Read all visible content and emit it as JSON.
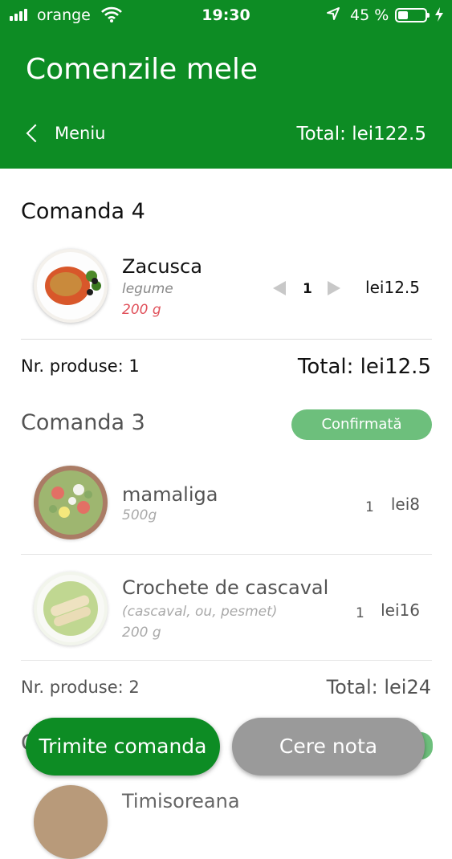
{
  "status_bar": {
    "carrier": "orange",
    "time": "19:30",
    "battery": "45 %",
    "battery_level": 0.45,
    "icons": [
      "signal-icon",
      "wifi-icon",
      "location-arrow-icon",
      "battery-icon",
      "charging-bolt-icon"
    ]
  },
  "header": {
    "title": "Comenzile mele",
    "back_label": "Meniu",
    "total": "Total: lei122.5",
    "color": "#0d8c24"
  },
  "orders": [
    {
      "title": "Comanda 4",
      "items": [
        {
          "name": "Zacusca",
          "description": "legume",
          "weight": "200 g",
          "quantity": "1",
          "price": "lei12.5"
        }
      ],
      "count_label": "Nr. produse: 1",
      "total": "Total: lei12.5"
    },
    {
      "title": "Comanda 3",
      "status": "Confirmată",
      "items": [
        {
          "name": "mamaliga",
          "weight": "500g",
          "quantity": "1",
          "price": "lei8"
        },
        {
          "name": "Crochete de cascaval",
          "description": "(cascaval, ou, pesmet)",
          "weight": "200 g",
          "quantity": "1",
          "price": "lei16"
        }
      ],
      "count_label": "Nr. produse: 2",
      "total": "Total: lei24"
    },
    {
      "title_initial": "C",
      "items": [
        {
          "name": "Timisoreana"
        }
      ]
    }
  ],
  "buttons": {
    "send": "Trimite comanda",
    "bill": "Cere nota"
  },
  "colors": {
    "accent": "#0d8c24",
    "badge": "#6dbf7c",
    "weight_red": "#e0505a",
    "button_gray": "#9a9a9a"
  }
}
